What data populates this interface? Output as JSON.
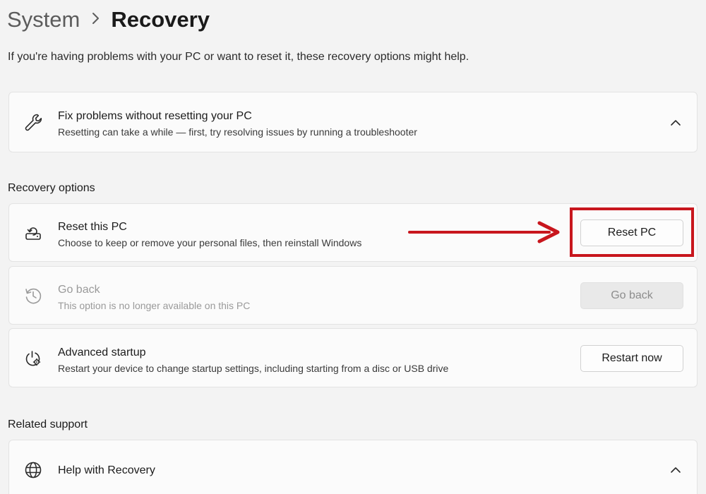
{
  "breadcrumb": {
    "parent": "System",
    "separator": "›",
    "current": "Recovery"
  },
  "intro": "If you're having problems with your PC or want to reset it, these recovery options might help.",
  "fix_card": {
    "icon": "wrench-icon",
    "title": "Fix problems without resetting your PC",
    "description": "Resetting can take a while — first, try resolving issues by running a troubleshooter",
    "expanded": true
  },
  "recovery_options": {
    "label": "Recovery options",
    "items": [
      {
        "icon": "reset-pc-icon",
        "title": "Reset this PC",
        "description": "Choose to keep or remove your personal files, then reinstall Windows",
        "button": "Reset PC",
        "enabled": true,
        "highlighted": true
      },
      {
        "icon": "history-icon",
        "title": "Go back",
        "description": "This option is no longer available on this PC",
        "button": "Go back",
        "enabled": false
      },
      {
        "icon": "advanced-startup-icon",
        "title": "Advanced startup",
        "description": "Restart your device to change startup settings, including starting from a disc or USB drive",
        "button": "Restart now",
        "enabled": true
      }
    ]
  },
  "related_support": {
    "label": "Related support",
    "items": [
      {
        "icon": "globe-icon",
        "title": "Help with Recovery",
        "expanded": true
      }
    ]
  },
  "colors": {
    "background": "#f3f3f3",
    "card": "#fbfbfb",
    "annotation": "#c8161d",
    "disabled_text": "#9a9a9a"
  }
}
